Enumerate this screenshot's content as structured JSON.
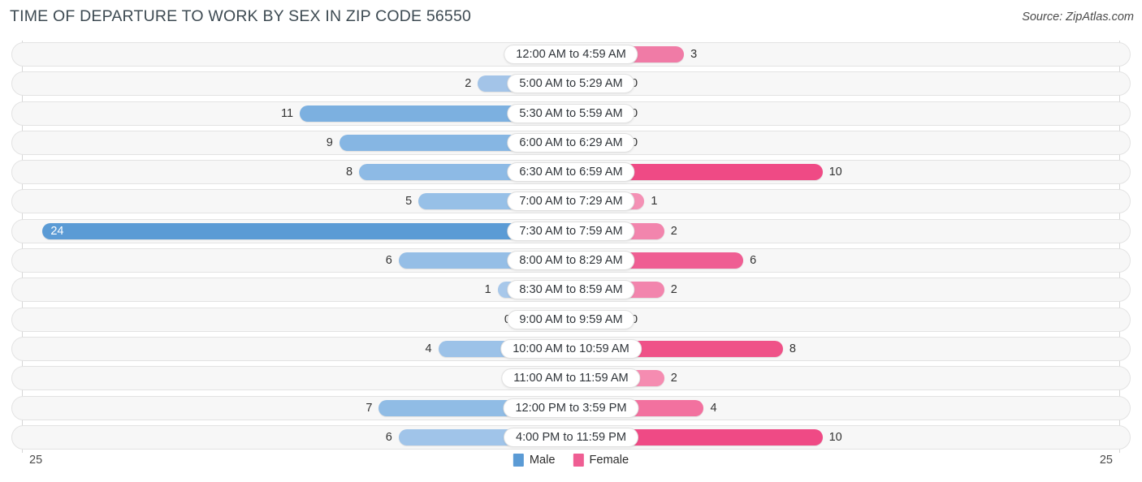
{
  "header": {
    "title": "TIME OF DEPARTURE TO WORK BY SEX IN ZIP CODE 56550",
    "source": "Source: ZipAtlas.com"
  },
  "legend": {
    "male_label": "Male",
    "female_label": "Female",
    "male_color": "#5b9bd5",
    "female_color": "#ef5e93"
  },
  "axis": {
    "left_tick": "25",
    "right_tick": "25",
    "max": 25
  },
  "chart_data": {
    "type": "bar",
    "orientation": "horizontal-diverging",
    "title": "TIME OF DEPARTURE TO WORK BY SEX IN ZIP CODE 56550",
    "xlabel": "",
    "ylabel": "",
    "xlim": [
      25,
      25
    ],
    "grid": false,
    "legend_position": "bottom-center",
    "categories": [
      "12:00 AM to 4:59 AM",
      "5:00 AM to 5:29 AM",
      "5:30 AM to 5:59 AM",
      "6:00 AM to 6:29 AM",
      "6:30 AM to 6:59 AM",
      "7:00 AM to 7:29 AM",
      "7:30 AM to 7:59 AM",
      "8:00 AM to 8:29 AM",
      "8:30 AM to 8:59 AM",
      "9:00 AM to 9:59 AM",
      "10:00 AM to 10:59 AM",
      "11:00 AM to 11:59 AM",
      "12:00 PM to 3:59 PM",
      "4:00 PM to 11:59 PM"
    ],
    "series": [
      {
        "name": "Male",
        "values": [
          0,
          2,
          11,
          9,
          8,
          5,
          24,
          6,
          1,
          0,
          4,
          0,
          7,
          6
        ]
      },
      {
        "name": "Female",
        "values": [
          3,
          0,
          0,
          0,
          10,
          1,
          2,
          6,
          2,
          0,
          8,
          2,
          4,
          10
        ]
      }
    ]
  },
  "rows": [
    {
      "label": "12:00 AM to 4:59 AM",
      "male": "0",
      "female": "3",
      "male_v": 0,
      "female_v": 3,
      "male_color": "#a8c8ea",
      "female_color": "#f07ba6"
    },
    {
      "label": "5:00 AM to 5:29 AM",
      "male": "2",
      "female": "0",
      "male_v": 2,
      "female_v": 0,
      "male_color": "#a3c4e8",
      "female_color": "#f694b7"
    },
    {
      "label": "5:30 AM to 5:59 AM",
      "male": "11",
      "female": "0",
      "male_v": 11,
      "female_v": 0,
      "male_color": "#7cb0e0",
      "female_color": "#f694b7"
    },
    {
      "label": "6:00 AM to 6:29 AM",
      "male": "9",
      "female": "0",
      "male_v": 9,
      "female_v": 0,
      "male_color": "#86b6e3",
      "female_color": "#f8a9c3"
    },
    {
      "label": "6:30 AM to 6:59 AM",
      "male": "8",
      "female": "10",
      "male_v": 8,
      "female_v": 10,
      "male_color": "#8dbae5",
      "female_color": "#ef4a85"
    },
    {
      "label": "7:00 AM to 7:29 AM",
      "male": "5",
      "female": "1",
      "male_v": 5,
      "female_v": 1,
      "male_color": "#97c0e7",
      "female_color": "#f491b5"
    },
    {
      "label": "7:30 AM to 7:59 AM",
      "male": "24",
      "female": "2",
      "male_v": 24,
      "female_v": 2,
      "male_color": "#5b9bd5",
      "female_color": "#f285ad"
    },
    {
      "label": "8:00 AM to 8:29 AM",
      "male": "6",
      "female": "6",
      "male_v": 6,
      "female_v": 6,
      "male_color": "#95bee6",
      "female_color": "#ef5e93"
    },
    {
      "label": "8:30 AM to 8:59 AM",
      "male": "1",
      "female": "2",
      "male_v": 1,
      "female_v": 2,
      "male_color": "#a8c8ea",
      "female_color": "#f285ad"
    },
    {
      "label": "9:00 AM to 9:59 AM",
      "male": "0",
      "female": "0",
      "male_v": 0,
      "female_v": 0,
      "male_color": "#a8c8ea",
      "female_color": "#f8a9c3"
    },
    {
      "label": "10:00 AM to 10:59 AM",
      "male": "4",
      "female": "8",
      "male_v": 4,
      "female_v": 8,
      "male_color": "#9cc2e8",
      "female_color": "#ef5288"
    },
    {
      "label": "11:00 AM to 11:59 AM",
      "male": "0",
      "female": "2",
      "male_v": 0,
      "female_v": 2,
      "male_color": "#a8c8ea",
      "female_color": "#f58cb1"
    },
    {
      "label": "12:00 PM to 3:59 PM",
      "male": "7",
      "female": "4",
      "male_v": 7,
      "female_v": 4,
      "male_color": "#90bce5",
      "female_color": "#f2719f"
    },
    {
      "label": "4:00 PM to 11:59 PM",
      "male": "6",
      "female": "10",
      "male_v": 6,
      "female_v": 10,
      "male_color": "#a0c4e9",
      "female_color": "#ef4a85"
    }
  ]
}
